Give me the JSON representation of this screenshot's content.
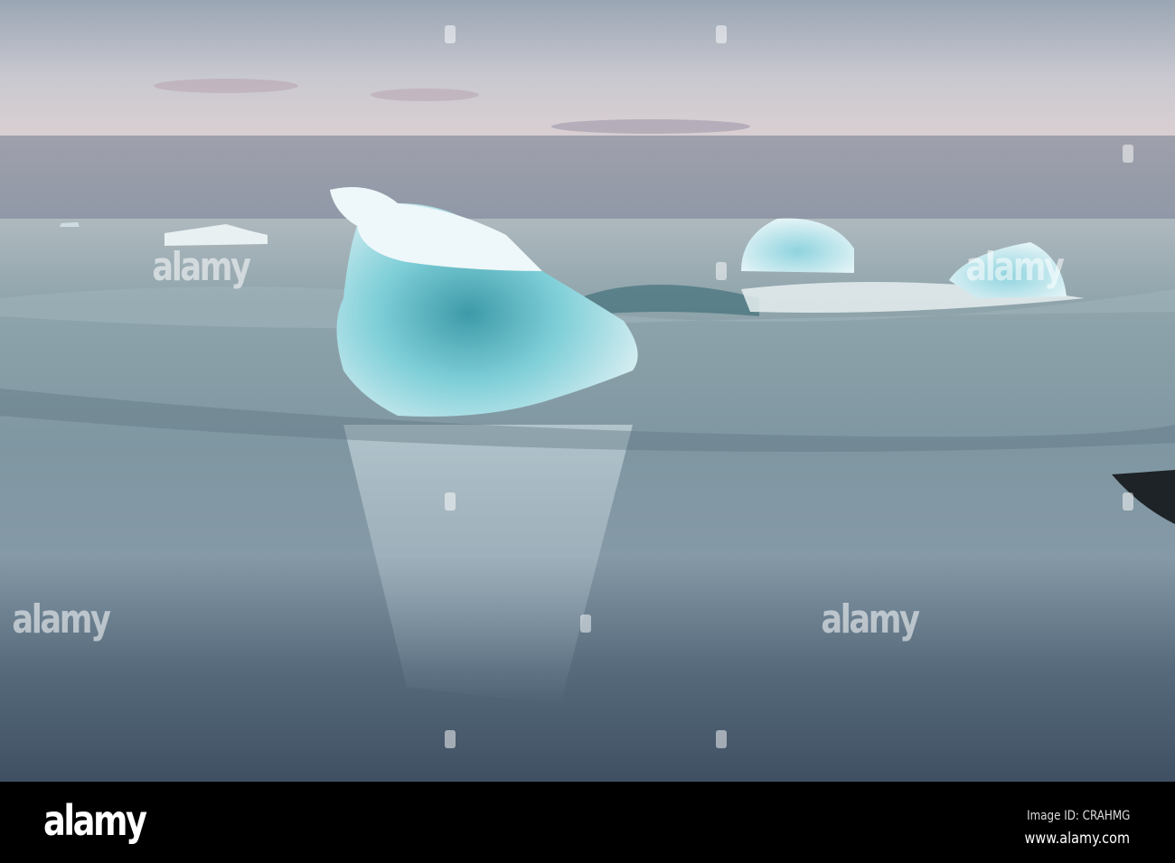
{
  "watermark": {
    "text": "alamy"
  },
  "footer": {
    "logo": "alamy",
    "image_id": "Image ID: CRAHMG",
    "website": "www.alamy.com"
  }
}
